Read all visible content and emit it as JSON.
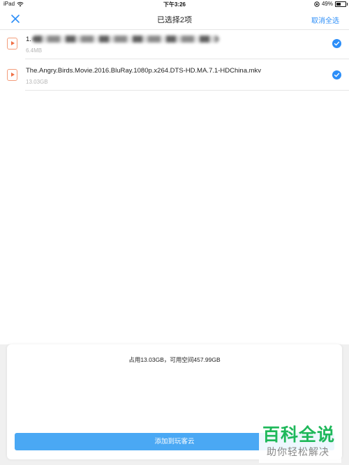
{
  "status_bar": {
    "device": "iPad",
    "time": "下午3:26",
    "battery_percent": "49%",
    "battery_level": 0.49
  },
  "nav": {
    "close_icon": "close-x-icon",
    "title": "已选择2项",
    "deselect_all": "取消全选"
  },
  "files": [
    {
      "name_prefix": "1.",
      "name_obscured": true,
      "size": "6.4MB",
      "selected": true,
      "icon": "video-play-icon"
    },
    {
      "name": "The.Angry.Birds.Movie.2016.BluRay.1080p.x264.DTS-HD.MA.7.1-HDChina.mkv",
      "size": "13.03GB",
      "selected": true,
      "icon": "video-play-icon"
    }
  ],
  "sheet": {
    "storage_info": "占用13.03GB，可用空间457.99GB",
    "add_button": "添加到玩客云"
  },
  "watermark": {
    "top": "百科全说",
    "bottom": "助你轻松解决"
  },
  "colors": {
    "accent": "#2c8ef8",
    "button": "#4aa8f4",
    "file_icon": "#f07046",
    "watermark": "#1eb85a"
  }
}
